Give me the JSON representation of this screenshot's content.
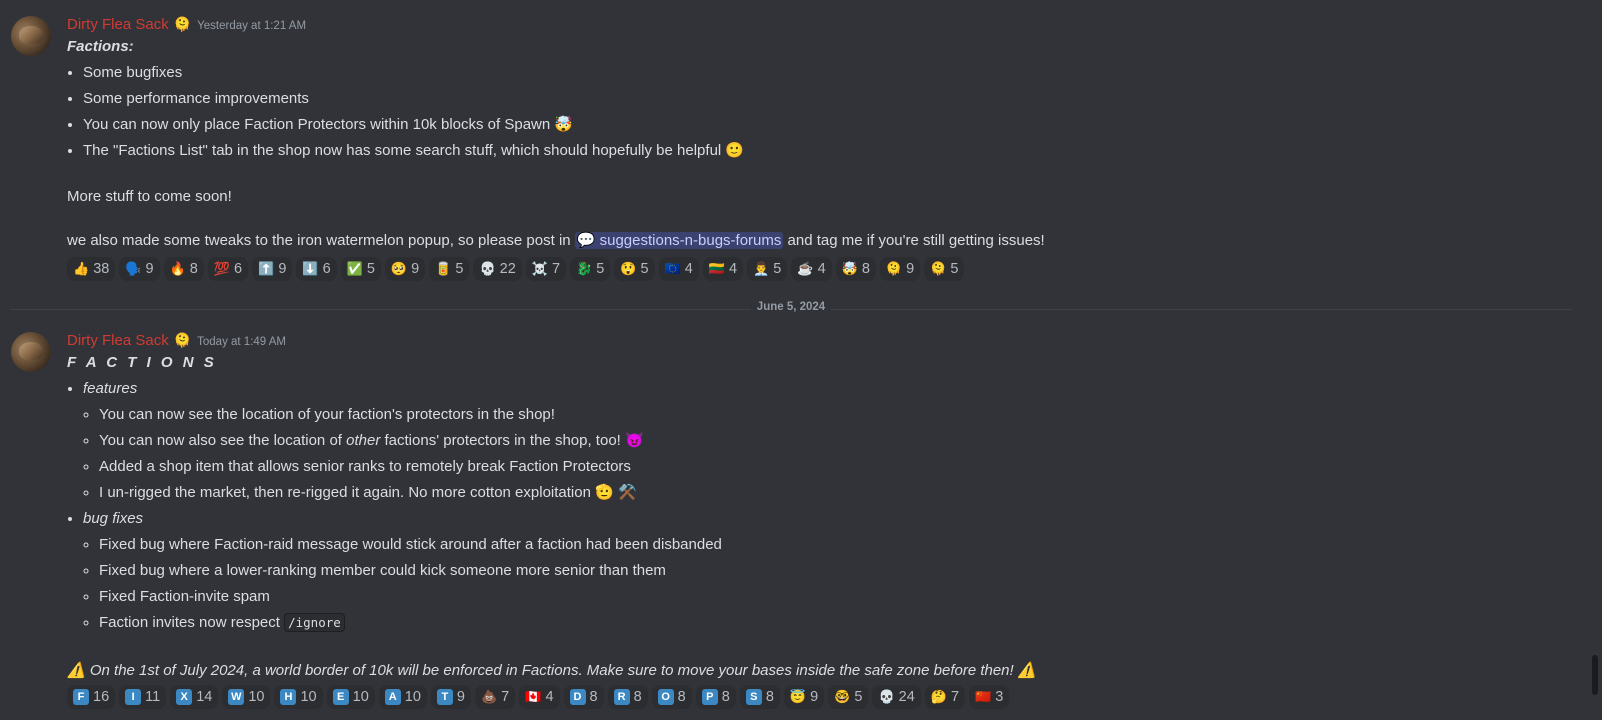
{
  "message1": {
    "author": "Dirty Flea Sack",
    "role_icon": "🫠",
    "timestamp": "Yesterday at 1:21 AM",
    "title": "Factions:",
    "bullets": [
      "Some bugfixes",
      "Some performance improvements",
      "You can now only place Faction Protectors within 10k blocks of Spawn 🤯",
      "The \"Factions List\" tab in the shop now has some search stuff, which should hopefully be helpful 🙂"
    ],
    "para1": "More stuff to come soon!",
    "para2_before": "we also made some tweaks to the iron watermelon popup, so please post in ",
    "mention": "💬 suggestions-n-bugs-forums",
    "para2_after": " and tag me if you're still getting issues!",
    "reactions": [
      {
        "e": "👍",
        "n": "38"
      },
      {
        "e": "🗣️",
        "n": "9"
      },
      {
        "e": "🔥",
        "n": "8"
      },
      {
        "e": "💯",
        "n": "6"
      },
      {
        "e": "⬆️",
        "n": "9"
      },
      {
        "e": "⬇️",
        "n": "6"
      },
      {
        "e": "✅",
        "n": "5"
      },
      {
        "e": "🥺",
        "n": "9"
      },
      {
        "e": "🥫",
        "n": "5"
      },
      {
        "e": "💀",
        "n": "22"
      },
      {
        "e": "☠️",
        "n": "7"
      },
      {
        "e": "🐉",
        "n": "5"
      },
      {
        "e": "😲",
        "n": "5"
      },
      {
        "e": "🇪🇺",
        "n": "4"
      },
      {
        "e": "🇱🇹",
        "n": "4"
      },
      {
        "e": "👨‍💼",
        "n": "5"
      },
      {
        "e": "☕",
        "n": "4"
      },
      {
        "e": "🤯",
        "n": "8"
      },
      {
        "e": "🫠",
        "n": "9"
      },
      {
        "e": "🫠",
        "n": "5"
      }
    ]
  },
  "divider_date": "June 5, 2024",
  "message2": {
    "author": "Dirty Flea Sack",
    "role_icon": "🫠",
    "timestamp": "Today at 1:49 AM",
    "title": "F A C T I O N S",
    "features_label": "features",
    "features": {
      "f1": "You can now see the location of your faction's protectors in the shop!",
      "f2_before": "You can now also see the location of ",
      "f2_italic": "other",
      "f2_after": " factions' protectors in the shop, too! 😈",
      "f3": "Added a shop item that allows senior ranks to remotely break Faction Protectors",
      "f4": "I un-rigged the market, then re-rigged it again. No more cotton exploitation 🫡 ⚒️"
    },
    "bugfix_label": "bug fixes",
    "bugfixes": {
      "b1": "Fixed bug where Faction-raid message would stick around after a faction had been disbanded",
      "b2": "Fixed bug where a lower-ranking member could kick someone more senior than them",
      "b3": "Fixed Faction-invite spam",
      "b4_before": "Faction invites now respect ",
      "b4_code": "/ignore"
    },
    "notice": "⚠️ On the 1st of July 2024, a world border of 10k will be enforced in Factions. Make sure to move your bases inside the safe zone before then! ⚠️",
    "reactions": [
      {
        "letter": "F",
        "n": "16"
      },
      {
        "letter": "I",
        "n": "11"
      },
      {
        "letter": "X",
        "n": "14"
      },
      {
        "letter": "W",
        "n": "10"
      },
      {
        "letter": "H",
        "n": "10"
      },
      {
        "letter": "E",
        "n": "10"
      },
      {
        "letter": "A",
        "n": "10"
      },
      {
        "letter": "T",
        "n": "9"
      },
      {
        "e": "💩",
        "n": "7"
      },
      {
        "e": "🇨🇦",
        "n": "4"
      },
      {
        "letter": "D",
        "n": "8"
      },
      {
        "letter": "R",
        "n": "8"
      },
      {
        "letter": "O",
        "n": "8"
      },
      {
        "letter": "P",
        "n": "8"
      },
      {
        "letter": "S",
        "n": "8"
      },
      {
        "e": "😇",
        "n": "9"
      },
      {
        "e": "🤓",
        "n": "5"
      },
      {
        "e": "💀",
        "n": "24"
      },
      {
        "e": "🤔",
        "n": "7"
      },
      {
        "e": "🇨🇳",
        "n": "3"
      }
    ]
  }
}
